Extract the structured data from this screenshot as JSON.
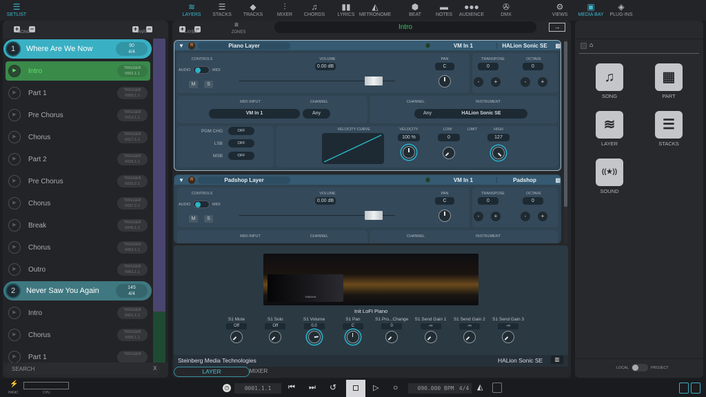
{
  "left_tab": {
    "label": "SETLIST",
    "icon": "hamburger-icon"
  },
  "setlist_toolbar": {
    "song_label": "SONG",
    "part_label": "PART"
  },
  "songs": [
    {
      "number": "1",
      "title": "Where Are We Now",
      "tempo": "90",
      "signature": "4/4",
      "parts": [
        {
          "name": "Intro",
          "trigger_label": "TRIGGER",
          "trigger": "0001.1.1",
          "active": true
        },
        {
          "name": "Part 1",
          "trigger_label": "TRIGGER",
          "trigger": "0005.1.1"
        },
        {
          "name": "Pre Chorus",
          "trigger_label": "TRIGGER",
          "trigger": "0013.1.1"
        },
        {
          "name": "Chorus",
          "trigger_label": "TRIGGER",
          "trigger": "0017.1.1"
        },
        {
          "name": "Part 2",
          "trigger_label": "TRIGGER",
          "trigger": "0025.1.1"
        },
        {
          "name": "Pre Chorus",
          "trigger_label": "TRIGGER",
          "trigger": "0033.2.1"
        },
        {
          "name": "Chorus",
          "trigger_label": "TRIGGER",
          "trigger": "0037.2.1"
        },
        {
          "name": "Break",
          "trigger_label": "TRIGGER",
          "trigger": "0045.1.1"
        },
        {
          "name": "Chorus",
          "trigger_label": "TRIGGER",
          "trigger": "0053.1.1"
        },
        {
          "name": "Outro",
          "trigger_label": "TRIGGER",
          "trigger": "0061.1.1"
        }
      ]
    },
    {
      "number": "2",
      "title": "Never Saw You Again",
      "tempo": "145",
      "signature": "4/4",
      "parts": [
        {
          "name": "Intro",
          "trigger_label": "TRIGGER",
          "trigger": "0001.1.1"
        },
        {
          "name": "Chorus",
          "trigger_label": "TRIGGER",
          "trigger": "0005.1.1"
        },
        {
          "name": "Part 1",
          "trigger_label": "TRIGGER",
          "trigger": ""
        }
      ]
    }
  ],
  "search": {
    "placeholder": "SEARCH",
    "clear": "X"
  },
  "status": {
    "panic": "PANIC",
    "cpu": "CPU"
  },
  "main_tabs": [
    {
      "label": "LAYERS",
      "icon": "layers-icon",
      "glyph": "≋"
    },
    {
      "label": "STACKS",
      "icon": "stacks-icon",
      "glyph": "☰"
    },
    {
      "label": "TRACKS",
      "icon": "cube-icon",
      "glyph": "◆"
    },
    {
      "label": "MIXER",
      "icon": "mixer-icon",
      "glyph": "⫶"
    },
    {
      "label": "CHORDS",
      "icon": "music-note-icon",
      "glyph": "♫"
    },
    {
      "label": "LYRICS",
      "icon": "book-icon",
      "glyph": "▮▮"
    },
    {
      "label": "METRONOME",
      "icon": "metronome-icon",
      "glyph": "◭"
    },
    {
      "label": "BEAT",
      "icon": "beat-icon",
      "glyph": "⬢"
    },
    {
      "label": "NOTES",
      "icon": "note-bubble-icon",
      "glyph": "▬"
    },
    {
      "label": "AUDIENCE",
      "icon": "audience-icon",
      "glyph": "●●●"
    },
    {
      "label": "DMX",
      "icon": "dmx-icon",
      "glyph": "✇"
    },
    {
      "label": "VIEWS",
      "icon": "gear-icon",
      "glyph": "⚙"
    }
  ],
  "layer_toolbar": {
    "layer_label": "LAYER",
    "zones_label": "ZONES",
    "current_part": "Intro"
  },
  "layers": [
    {
      "name": "Piano Layer",
      "record": "R",
      "midi_in": "VM In 1",
      "instrument": "HALion Sonic SE",
      "controls": "CONTROLS",
      "audio": "AUDIO",
      "midi": "MIDI",
      "mute": "M",
      "solo": "S",
      "volume_label": "VOLUME",
      "volume": "0.00 dB",
      "pan_label": "PAN",
      "pan": "C",
      "transpose_label": "TRANSPOSE",
      "transpose": "0",
      "octave_label": "OCTAVE",
      "octave": "0",
      "minus": "-",
      "plus": "+",
      "midi_input_label": "MIDI INPUT",
      "channel_label": "CHANNEL",
      "in_channel": "Any",
      "out_channel": "Any",
      "instrument_label": "INSTRUMENT",
      "pgm_label": "PGM CHG",
      "pgm": "OFF",
      "lsb_label": "LSB",
      "lsb": "OFF",
      "msb_label": "MSB",
      "msb": "OFF",
      "curve_label": "VELOCITY CURVE",
      "velocity_label": "VELOCITY",
      "velocity": "100 %",
      "low_label": "LOW",
      "low": "0",
      "limit_label": "LIMIT",
      "high_label": "HIGH",
      "high": "127"
    },
    {
      "name": "Padshop Layer",
      "record": "R",
      "midi_in": "VM In 1",
      "instrument": "Padshop",
      "controls": "CONTROLS",
      "audio": "AUDIO",
      "midi": "MIDI",
      "mute": "M",
      "solo": "S",
      "volume_label": "VOLUME",
      "volume": "0.00 dB",
      "pan_label": "PAN",
      "pan": "C",
      "transpose_label": "TRANSPOSE",
      "transpose": "0",
      "octave_label": "OCTAVE",
      "octave": "0",
      "minus": "-",
      "plus": "+",
      "midi_input_label": "MIDI INPUT",
      "channel_label": "CHANNEL",
      "instrument_label": "INSTRUMENT"
    }
  ],
  "plugin": {
    "preset": "Init LoFI Piano",
    "vendor": "Steinberg Media Technologies",
    "name": "HALion Sonic SE",
    "brand": "YAMAHA",
    "params": [
      {
        "label": "S1 Mute",
        "value": "Off",
        "level": 0
      },
      {
        "label": "S1 Solo",
        "value": "Off",
        "level": 0
      },
      {
        "label": "S1 Volume",
        "value": "0.0",
        "level": 0.8
      },
      {
        "label": "S1 Pan",
        "value": "C",
        "level": 0.5
      },
      {
        "label": "S1 Pro...Change",
        "value": "0",
        "level": 0
      },
      {
        "label": "S1 Send Gain 1",
        "value": "-∞",
        "level": 0
      },
      {
        "label": "S1 Send Gain 2",
        "value": "-∞",
        "level": 0
      },
      {
        "label": "S1 Send Gain 3",
        "value": "-∞",
        "level": 0
      }
    ]
  },
  "bottom_tabs": [
    {
      "label": "LAYER",
      "active": true
    },
    {
      "label": "MIXER"
    }
  ],
  "transport": {
    "position": "0001.1.1",
    "tempo": "090.000 BPM",
    "signature": "4/4"
  },
  "right_tabs": [
    {
      "label": "MEDIA BAY",
      "active": true
    },
    {
      "label": "PLUG-INS"
    }
  ],
  "media_bay": {
    "items": [
      {
        "label": "SONG",
        "icon": "music-note-icon",
        "glyph": "♫"
      },
      {
        "label": "PART",
        "icon": "part-grid-icon",
        "glyph": "▦"
      },
      {
        "label": "LAYER",
        "icon": "layers-icon",
        "glyph": "≋"
      },
      {
        "label": "STACKS",
        "icon": "stacks-icon",
        "glyph": "☰"
      },
      {
        "label": "SOUND",
        "icon": "sound-icon",
        "glyph": "((★))"
      }
    ],
    "local": "LOCAL",
    "project": "PROJECT"
  },
  "colors": {
    "accent": "#34b3c7",
    "song_active": "#3ab0c4",
    "part_active": "#3a8a4a",
    "song_inactive": "#3f7880"
  }
}
